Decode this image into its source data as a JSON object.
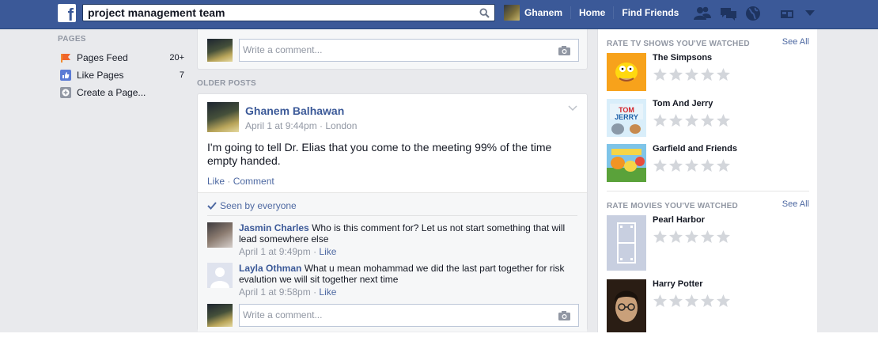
{
  "topbar": {
    "logo_letter": "f",
    "search_value": "project management team",
    "user_name": "Ghanem",
    "home_label": "Home",
    "find_friends_label": "Find Friends",
    "brand_color": "#3b5998"
  },
  "sidebar": {
    "heading": "PAGES",
    "items": [
      {
        "label": "Pages Feed",
        "count": "20+",
        "icon": "pages-feed-icon"
      },
      {
        "label": "Like Pages",
        "count": "7",
        "icon": "like-pages-icon"
      },
      {
        "label": "Create a Page...",
        "count": "",
        "icon": "create-page-icon"
      }
    ]
  },
  "feed": {
    "top_comment_placeholder": "Write a comment...",
    "older_posts_label": "OLDER POSTS",
    "post": {
      "author": "Ghanem Balhawan",
      "meta": "April 1 at 9:44pm · London",
      "text": "I'm going to tell Dr. Elias that you come to the meeting 99% of the time empty handed.",
      "like_label": "Like",
      "comment_label": "Comment",
      "seen_label": "Seen by everyone",
      "comments": [
        {
          "name": "Jasmin Charles",
          "text": "Who is this comment for? Let us not start something that will lead somewhere else",
          "time": "April 1 at 9:49pm",
          "like": "Like"
        },
        {
          "name": "Layla Othman",
          "text": "What u mean mohammad we did the last part together for risk evalution we will sit together next time",
          "time": "April 1 at 9:58pm",
          "like": "Like"
        }
      ],
      "comment_placeholder": "Write a comment..."
    }
  },
  "right_column": {
    "tv_heading": "RATE TV SHOWS YOU'VE WATCHED",
    "tv_see_all": "See All",
    "tv_shows": [
      {
        "name": "The Simpsons",
        "stars": 0
      },
      {
        "name": "Tom And Jerry",
        "stars": 0
      },
      {
        "name": "Garfield and Friends",
        "stars": 0
      }
    ],
    "movies_heading": "RATE MOVIES YOU'VE WATCHED",
    "movies_see_all": "See All",
    "movies": [
      {
        "name": "Pearl Harbor",
        "stars": 0
      },
      {
        "name": "Harry Potter",
        "stars": 0
      }
    ]
  }
}
